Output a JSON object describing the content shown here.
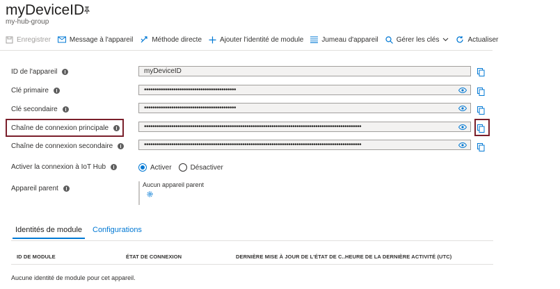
{
  "header": {
    "title": "myDeviceID",
    "subtitle": "my-hub-group"
  },
  "toolbar": {
    "save": "Enregistrer",
    "message": "Message à l'appareil",
    "direct_method": "Méthode directe",
    "add_module": "Ajouter l'identité de module",
    "twin": "Jumeau d'appareil",
    "manage_keys": "Gérer les clés",
    "refresh": "Actualiser"
  },
  "form": {
    "device_id_label": "ID de l'appareil",
    "device_id_value": "myDeviceID",
    "primary_key_label": "Clé primaire",
    "primary_key_value": "••••••••••••••••••••••••••••••••••••••••••••",
    "secondary_key_label": "Clé secondaire",
    "secondary_key_value": "••••••••••••••••••••••••••••••••••••••••••••",
    "primary_conn_label": "Chaîne de connexion principale",
    "primary_conn_value": "••••••••••••••••••••••••••••••••••••••••••••••••••••••••••••••••••••••••••••••••••••••••••••••••••••••••",
    "secondary_conn_label": "Chaîne de connexion secondaire",
    "secondary_conn_value": "••••••••••••••••••••••••••••••••••••••••••••••••••••••••••••••••••••••••••••••••••••••••••••••••••••••••",
    "iot_hub_label": "Activer la connexion à IoT Hub",
    "enable_label": "Activer",
    "disable_label": "Désactiver",
    "parent_label": "Appareil parent",
    "parent_value": "Aucun appareil parent"
  },
  "tabs": {
    "modules": "Identités de module",
    "configurations": "Configurations"
  },
  "table": {
    "col1": "ID DE MODULE",
    "col2": "ÉTAT DE CONNEXION",
    "col3": "DERNIÈRE MISE À JOUR DE L'ÉTAT DE C...",
    "col4": "HEURE DE LA DERNIÈRE ACTIVITÉ (UTC)",
    "empty": "Aucune identité de module pour cet appareil."
  },
  "colors": {
    "accent": "#0078d4",
    "highlight": "#7a1f2b"
  }
}
